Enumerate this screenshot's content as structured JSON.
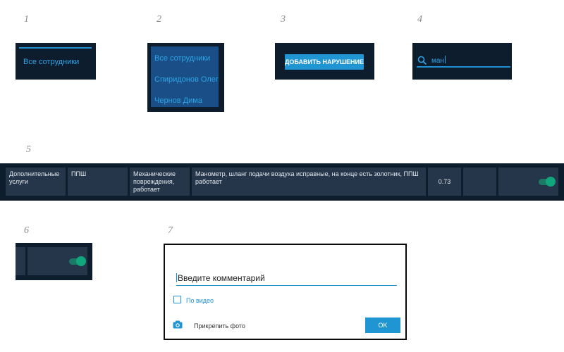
{
  "numbers": [
    "1",
    "2",
    "3",
    "4",
    "5",
    "6",
    "7"
  ],
  "panel1": {
    "tab_label": "Все сотрудники"
  },
  "panel2": {
    "items": [
      "Все сотрудники",
      "Спиридонов Олег",
      "Чернов Дима"
    ]
  },
  "panel3": {
    "button_label": "ДОБАВИТЬ НАРУШЕНИЕ"
  },
  "panel4": {
    "search_value": "ман",
    "search_icon": "search-icon"
  },
  "panel5": {
    "cells": [
      "Дополнительные услуги",
      "ППШ",
      "Механические повреждения, работает",
      "Манометр, шланг подачи воздуха исправные, на конце есть золотник, ППШ работает",
      "0.73",
      ""
    ],
    "toggle_on": true
  },
  "panel6": {
    "toggle_on": true
  },
  "panel7": {
    "comment_placeholder": "Введите комментарий",
    "checkbox_label": "По видео",
    "checkbox_checked": false,
    "attach_label": "Прикрепить фото",
    "camera_icon": "camera-icon",
    "ok_label": "OK"
  },
  "colors": {
    "panel_bg": "#0d1d2e",
    "cell_bg": "#25364a",
    "accent": "#1f95d3",
    "link_text": "#2ea3e6",
    "toggle_on": "#10a77d"
  }
}
